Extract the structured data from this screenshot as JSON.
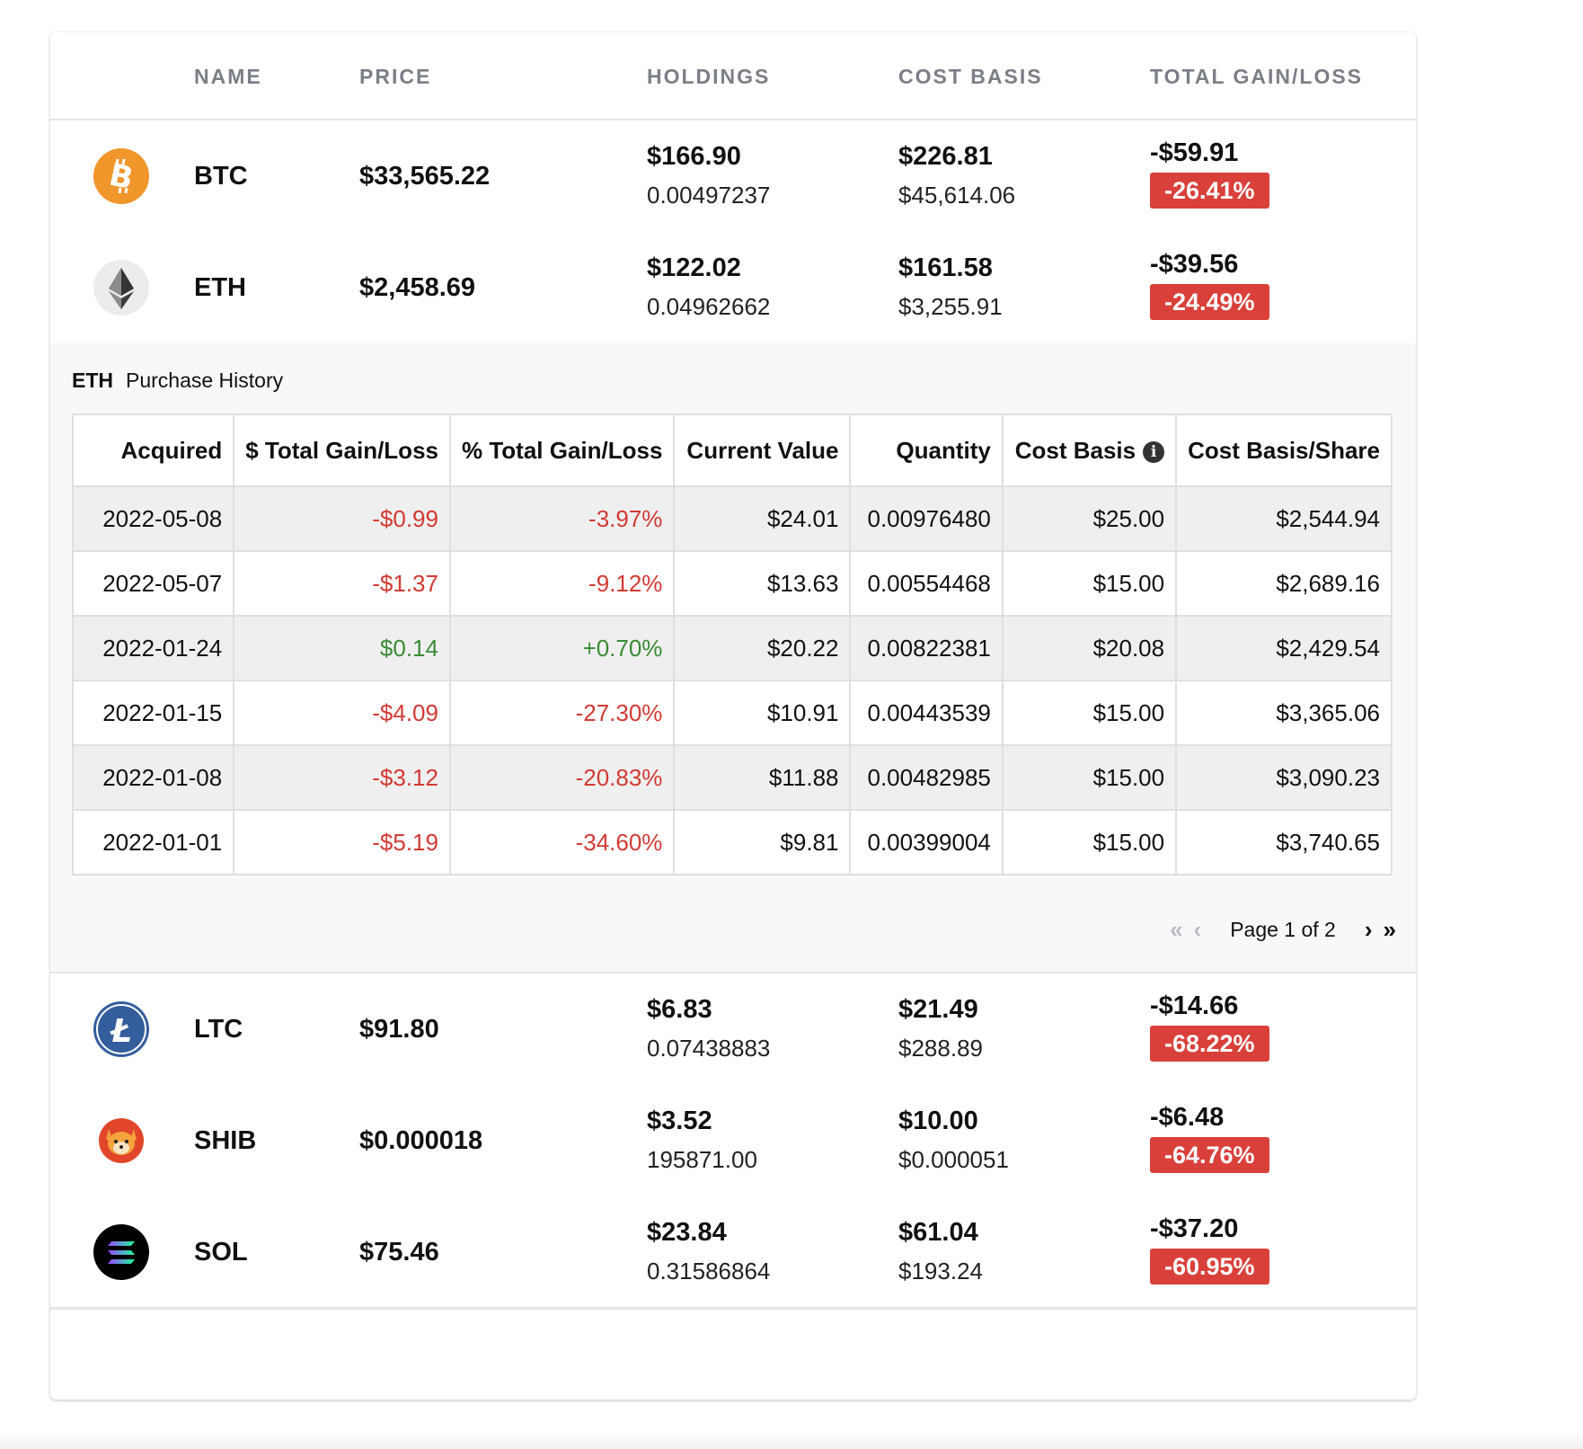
{
  "header": {
    "name": "NAME",
    "price": "PRICE",
    "holdings": "HOLDINGS",
    "cost_basis": "COST BASIS",
    "total_gain_loss": "TOTAL GAIN/LOSS"
  },
  "assets": [
    {
      "symbol": "BTC",
      "price": "$33,565.22",
      "holdings_value": "$166.90",
      "holdings_qty": "0.00497237",
      "cost_basis": "$226.81",
      "cost_per": "$45,614.06",
      "gain": "-$59.91",
      "gain_pct": "-26.41%",
      "icon": "bitcoin-icon",
      "color": "#f0962b"
    },
    {
      "symbol": "ETH",
      "price": "$2,458.69",
      "holdings_value": "$122.02",
      "holdings_qty": "0.04962662",
      "cost_basis": "$161.58",
      "cost_per": "$3,255.91",
      "gain": "-$39.56",
      "gain_pct": "-24.49%",
      "icon": "ethereum-icon",
      "color": "#ececec"
    },
    {
      "symbol": "LTC",
      "price": "$91.80",
      "holdings_value": "$6.83",
      "holdings_qty": "0.07438883",
      "cost_basis": "$21.49",
      "cost_per": "$288.89",
      "gain": "-$14.66",
      "gain_pct": "-68.22%",
      "icon": "litecoin-icon",
      "color": "#345d9d"
    },
    {
      "symbol": "SHIB",
      "price": "$0.000018",
      "holdings_value": "$3.52",
      "holdings_qty": "195871.00",
      "cost_basis": "$10.00",
      "cost_per": "$0.000051",
      "gain": "-$6.48",
      "gain_pct": "-64.76%",
      "icon": "shiba-inu-icon",
      "color": "#e2462a"
    },
    {
      "symbol": "SOL",
      "price": "$75.46",
      "holdings_value": "$23.84",
      "holdings_qty": "0.31586864",
      "cost_basis": "$61.04",
      "cost_per": "$193.24",
      "gain": "-$37.20",
      "gain_pct": "-60.95%",
      "icon": "solana-icon",
      "color": "#000000"
    }
  ],
  "history": {
    "symbol": "ETH",
    "title": "Purchase History",
    "columns": [
      "Acquired",
      "$ Total Gain/Loss",
      "% Total Gain/Loss",
      "Current Value",
      "Quantity",
      "Cost Basis",
      "Cost Basis/Share"
    ],
    "info_icon": "info-icon",
    "rows": [
      {
        "acquired": "2022-05-08",
        "gain": "-$0.99",
        "gain_pct": "-3.97%",
        "current": "$24.01",
        "qty": "0.00976480",
        "cost": "$25.00",
        "per_share": "$2,544.94"
      },
      {
        "acquired": "2022-05-07",
        "gain": "-$1.37",
        "gain_pct": "-9.12%",
        "current": "$13.63",
        "qty": "0.00554468",
        "cost": "$15.00",
        "per_share": "$2,689.16"
      },
      {
        "acquired": "2022-01-24",
        "gain": "$0.14",
        "gain_pct": "+0.70%",
        "current": "$20.22",
        "qty": "0.00822381",
        "cost": "$20.08",
        "per_share": "$2,429.54"
      },
      {
        "acquired": "2022-01-15",
        "gain": "-$4.09",
        "gain_pct": "-27.30%",
        "current": "$10.91",
        "qty": "0.00443539",
        "cost": "$15.00",
        "per_share": "$3,365.06"
      },
      {
        "acquired": "2022-01-08",
        "gain": "-$3.12",
        "gain_pct": "-20.83%",
        "current": "$11.88",
        "qty": "0.00482985",
        "cost": "$15.00",
        "per_share": "$3,090.23"
      },
      {
        "acquired": "2022-01-01",
        "gain": "-$5.19",
        "gain_pct": "-34.60%",
        "current": "$9.81",
        "qty": "0.00399004",
        "cost": "$15.00",
        "per_share": "$3,740.65"
      }
    ],
    "pagination": {
      "label": "Page 1 of 2",
      "first": "«",
      "prev": "‹",
      "next": "›",
      "last": "»"
    }
  },
  "colors": {
    "negative": "#d23a33",
    "positive": "#3a8a35",
    "badge": "#d9403a"
  }
}
